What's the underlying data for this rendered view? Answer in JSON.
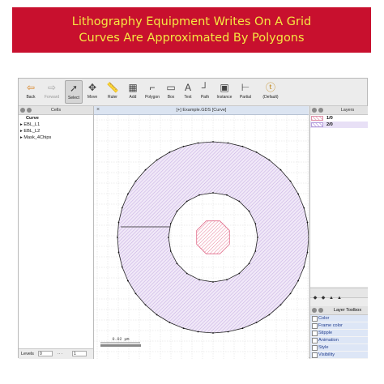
{
  "banner": {
    "line1": "Lithography Equipment Writes On A Grid",
    "line2": "Curves Are Approximated By Polygons"
  },
  "toolbar": {
    "items": [
      {
        "label": "Back",
        "icon": "back-arrow-icon"
      },
      {
        "label": "Forward",
        "icon": "forward-arrow-icon"
      },
      {
        "label": "Select",
        "icon": "cursor-arrow-icon"
      },
      {
        "label": "Move",
        "icon": "move-cross-icon"
      },
      {
        "label": "Ruler",
        "icon": "ruler-icon"
      },
      {
        "label": "Add",
        "icon": "add-icon"
      },
      {
        "label": "Polygon",
        "icon": "polygon-icon"
      },
      {
        "label": "Box",
        "icon": "box-icon"
      },
      {
        "label": "Text",
        "icon": "text-icon"
      },
      {
        "label": "Path",
        "icon": "path-icon"
      },
      {
        "label": "Instance",
        "icon": "instance-icon"
      },
      {
        "label": "Partial",
        "icon": "partial-icon"
      },
      {
        "label": "(Default)",
        "icon": "mode-icon"
      }
    ]
  },
  "cells": {
    "title": "Cells",
    "items": [
      "Curve",
      "EBL_L1",
      "EBL_L2",
      "Mask_4Chips"
    ]
  },
  "levels": {
    "label": "Levels",
    "from": "0",
    "to": "1"
  },
  "canvas": {
    "tab_title": "[+] Example.GDS [Curve]",
    "scale_label": "0.02 µm"
  },
  "layers": {
    "title": "Layers",
    "items": [
      {
        "name": "1/0",
        "color": "#e8b7c6"
      },
      {
        "name": "2/0",
        "color": "#c9b7e8"
      }
    ]
  },
  "layer_toolbox": {
    "title": "Layer Toolbox",
    "items": [
      "Color",
      "Frame color",
      "Stipple",
      "Animation",
      "Style",
      "Visibility"
    ]
  },
  "colors": {
    "banner_bg": "#c8102e",
    "banner_text": "#f5e642",
    "ring_fill": "#c9b2e4",
    "ring_stroke": "#222222",
    "small_poly": "#e87f9a",
    "grid": "#d6d6d6"
  }
}
